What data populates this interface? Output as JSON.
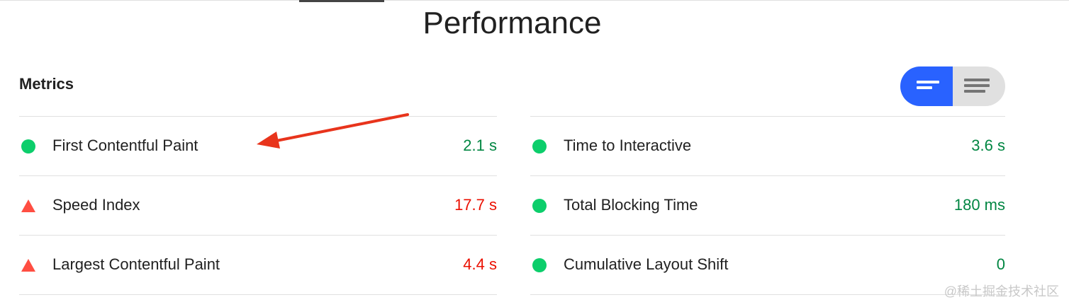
{
  "page": {
    "title": "Performance",
    "metrics_heading": "Metrics"
  },
  "view_toggle": {
    "active": "compact",
    "options": [
      "compact-view-icon",
      "expanded-view-icon"
    ],
    "active_color": "#2962ff"
  },
  "metrics_left": [
    {
      "label": "First Contentful Paint",
      "value": "2.1 s",
      "status": "pass"
    },
    {
      "label": "Speed Index",
      "value": "17.7 s",
      "status": "fail"
    },
    {
      "label": "Largest Contentful Paint",
      "value": "4.4 s",
      "status": "fail"
    }
  ],
  "metrics_right": [
    {
      "label": "Time to Interactive",
      "value": "3.6 s",
      "status": "pass"
    },
    {
      "label": "Total Blocking Time",
      "value": "180 ms",
      "status": "pass"
    },
    {
      "label": "Cumulative Layout Shift",
      "value": "0",
      "status": "pass"
    }
  ],
  "annotation": {
    "type": "arrow",
    "color": "#e8341c",
    "points_to": "First Contentful Paint"
  },
  "watermark": "@稀土掘金技术社区",
  "colors": {
    "pass": "#0cce6b",
    "pass_text": "#018642",
    "fail": "#ff4e42",
    "fail_text": "#eb0f00"
  }
}
